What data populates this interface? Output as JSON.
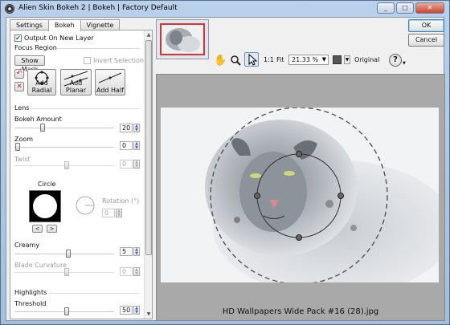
{
  "window": {
    "title": "Alien Skin Bokeh 2 | Bokeh | Factory Default"
  },
  "tabs": [
    {
      "label": "Settings"
    },
    {
      "label": "Bokeh"
    },
    {
      "label": "Vignette"
    }
  ],
  "panel": {
    "output_new_layer": {
      "label": "Output On New Layer",
      "checked": true
    },
    "focus_region": {
      "heading": "Focus Region",
      "show_mask": "Show Mask",
      "invert_selection": "Invert Selection",
      "add_radial": "Add Radial",
      "add_planar": "Add Planar",
      "add_half": "Add Half"
    },
    "lens": {
      "heading": "Lens",
      "bokeh_amount": {
        "label": "Bokeh Amount",
        "value": "20"
      },
      "zoom": {
        "label": "Zoom",
        "value": "0"
      },
      "twist": {
        "label": "Twist",
        "value": "0"
      },
      "circle": {
        "label": "Circle",
        "prev": "<",
        "next": ">"
      },
      "rotation": {
        "label": "Rotation (°)",
        "value": "0"
      },
      "creamy": {
        "label": "Creamy",
        "value": "5"
      },
      "blade_curvature": {
        "label": "Blade Curvature",
        "value": "0"
      }
    },
    "highlights": {
      "heading": "Highlights",
      "threshold": {
        "label": "Threshold",
        "value": "50"
      }
    }
  },
  "toolbar": {
    "one_to_one": "1:1",
    "fit": "Fit",
    "zoom_value": "21.33 %",
    "original": "Original",
    "help": "?"
  },
  "dialog": {
    "ok": "OK",
    "cancel": "Cancel"
  },
  "preview": {
    "filename": "HD Wallpapers Wide Pack #16 (28).jpg"
  },
  "colors": {
    "accent_border": "#e0302a",
    "ok_focus": "#3c7fb1"
  }
}
